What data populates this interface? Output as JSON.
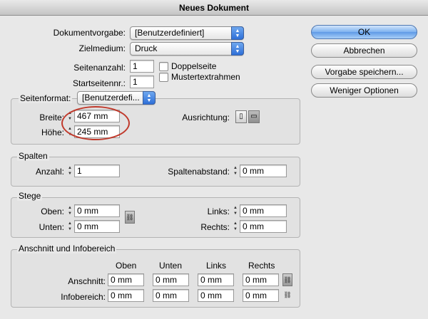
{
  "window": {
    "title": "Neues Dokument"
  },
  "top": {
    "preset_label": "Dokumentvorgabe:",
    "preset_value": "[Benutzerdefiniert]",
    "medium_label": "Zielmedium:",
    "medium_value": "Druck",
    "pages_label": "Seitenanzahl:",
    "pages_value": "1",
    "start_label": "Startseitennr.:",
    "start_value": "1",
    "facing_label": "Doppelseite",
    "master_label": "Mustertextrahmen"
  },
  "buttons": {
    "ok": "OK",
    "cancel": "Abbrechen",
    "save_preset": "Vorgabe speichern...",
    "fewer_options": "Weniger Optionen"
  },
  "page_size": {
    "label": "Seitenformat:",
    "value": "[Benutzerdefi...",
    "width_label": "Breite:",
    "width_value": "467 mm",
    "height_label": "Höhe:",
    "height_value": "245 mm",
    "orientation_label": "Ausrichtung:"
  },
  "columns": {
    "title": "Spalten",
    "count_label": "Anzahl:",
    "count_value": "1",
    "gutter_label": "Spaltenabstand:",
    "gutter_value": "0 mm"
  },
  "margins": {
    "title": "Stege",
    "top_label": "Oben:",
    "top_value": "0 mm",
    "bottom_label": "Unten:",
    "bottom_value": "0 mm",
    "left_label": "Links:",
    "left_value": "0 mm",
    "right_label": "Rechts:",
    "right_value": "0 mm"
  },
  "bleed": {
    "title": "Anschnitt und Infobereich",
    "col_top": "Oben",
    "col_bottom": "Unten",
    "col_left": "Links",
    "col_right": "Rechts",
    "bleed_label": "Anschnitt:",
    "slug_label": "Infobereich:",
    "bleed_values": [
      "0 mm",
      "0 mm",
      "0 mm",
      "0 mm"
    ],
    "slug_values": [
      "0 mm",
      "0 mm",
      "0 mm",
      "0 mm"
    ]
  },
  "colors": {
    "highlight_circle": "#c0392b",
    "accent": "#3f86e5"
  }
}
